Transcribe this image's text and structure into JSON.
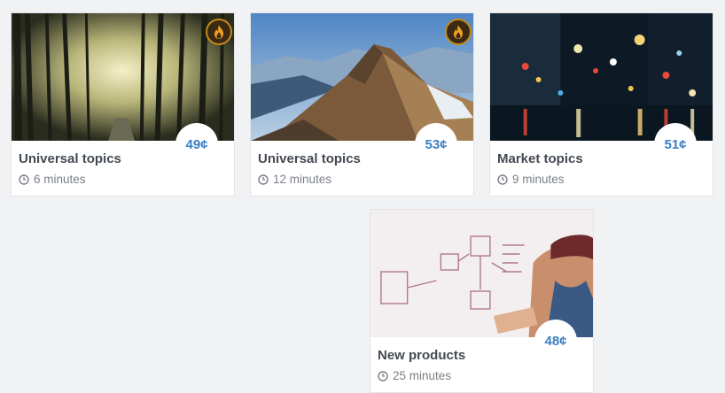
{
  "cards": [
    {
      "title": "Universal topics",
      "duration": "6 minutes",
      "price": "49¢",
      "hot": true,
      "scene": "forest-icon"
    },
    {
      "title": "Universal topics",
      "duration": "12 minutes",
      "price": "53¢",
      "hot": true,
      "scene": "mountain-icon"
    },
    {
      "title": "Market topics",
      "duration": "9 minutes",
      "price": "51¢",
      "hot": false,
      "scene": "city-lights-icon"
    },
    {
      "title": "New products",
      "duration": "25 minutes",
      "price": "48¢",
      "hot": false,
      "scene": "whiteboard-icon"
    }
  ],
  "colors": {
    "accent": "#3b7fc4",
    "badge_ring": "#c58a16",
    "badge_flame": "#f0a020"
  }
}
